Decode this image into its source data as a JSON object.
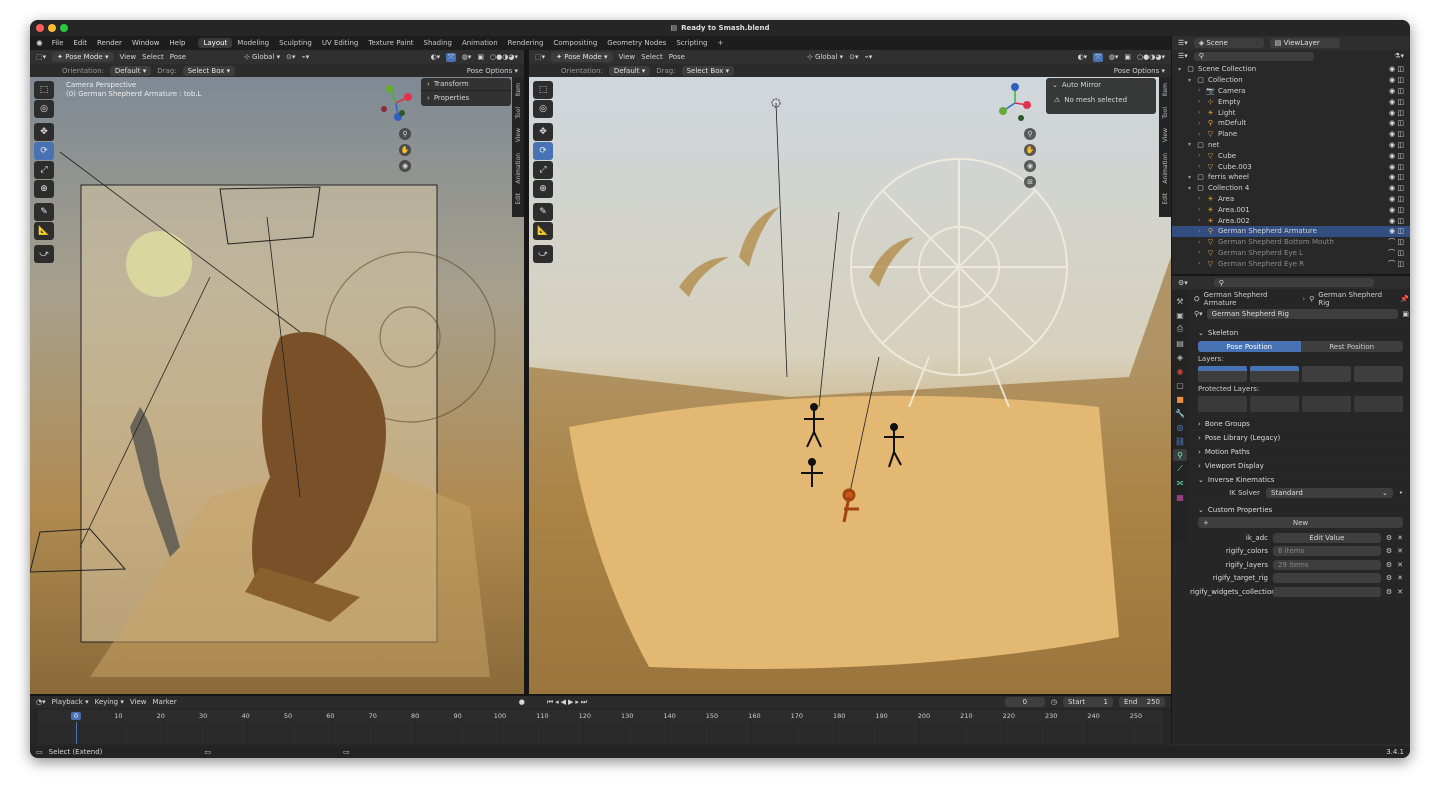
{
  "window": {
    "title": "Ready to Smash.blend",
    "version": "3.4.1"
  },
  "menu": {
    "items": [
      "File",
      "Edit",
      "Render",
      "Window",
      "Help"
    ]
  },
  "workspaces": [
    {
      "label": "Layout",
      "active": true
    },
    {
      "label": "Modeling"
    },
    {
      "label": "Sculpting"
    },
    {
      "label": "UV Editing"
    },
    {
      "label": "Texture Paint"
    },
    {
      "label": "Shading"
    },
    {
      "label": "Animation"
    },
    {
      "label": "Rendering"
    },
    {
      "label": "Compositing"
    },
    {
      "label": "Geometry Nodes"
    },
    {
      "label": "Scripting"
    }
  ],
  "left_viewport": {
    "mode": "Pose Mode",
    "menus": [
      "View",
      "Select",
      "Pose"
    ],
    "transform_space": "Global",
    "orientation_label": "Orientation:",
    "orientation_value": "Default",
    "drag_label": "Drag:",
    "drag_value": "Select Box",
    "pose_options": "Pose Options",
    "info_line1": "Camera Perspective",
    "info_line2": "(0) German Shepherd Armature : tob.L",
    "npanel": {
      "transform": "Transform",
      "properties": "Properties"
    },
    "tabs": [
      "Item",
      "Tool",
      "View",
      "Animation",
      "Edit"
    ]
  },
  "right_viewport": {
    "mode": "Pose Mode",
    "menus": [
      "View",
      "Select",
      "Pose"
    ],
    "transform_space": "Global",
    "orientation_label": "Orientation:",
    "orientation_value": "Default",
    "drag_label": "Drag:",
    "drag_value": "Select Box",
    "pose_options": "Pose Options",
    "auto_mirror": {
      "title": "Auto Mirror",
      "message": "No mesh selected"
    },
    "tabs": [
      "Item",
      "Tool",
      "View",
      "Animation",
      "Edit"
    ]
  },
  "outliner": {
    "scene": "Scene",
    "view_layer": "ViewLayer",
    "rows": [
      {
        "label": "Scene Collection",
        "depth": 0,
        "icon": "collection-icon"
      },
      {
        "label": "Collection",
        "depth": 1,
        "icon": "collection-icon"
      },
      {
        "label": "Camera",
        "depth": 2,
        "icon": "camera-icon"
      },
      {
        "label": "Empty",
        "depth": 2,
        "icon": "empty-icon"
      },
      {
        "label": "Light",
        "depth": 2,
        "icon": "light-icon"
      },
      {
        "label": "mDefult",
        "depth": 2,
        "icon": "armature-icon"
      },
      {
        "label": "Plane",
        "depth": 2,
        "icon": "mesh-icon"
      },
      {
        "label": "net",
        "depth": 1,
        "icon": "collection-icon"
      },
      {
        "label": "Cube",
        "depth": 2,
        "icon": "mesh-icon"
      },
      {
        "label": "Cube.003",
        "depth": 2,
        "icon": "mesh-icon"
      },
      {
        "label": "ferris wheel",
        "depth": 1,
        "icon": "collection-icon"
      },
      {
        "label": "Collection 4",
        "depth": 1,
        "icon": "collection-icon"
      },
      {
        "label": "Area",
        "depth": 2,
        "icon": "light-icon"
      },
      {
        "label": "Area.001",
        "depth": 2,
        "icon": "light-icon"
      },
      {
        "label": "Area.002",
        "depth": 2,
        "icon": "light-icon"
      },
      {
        "label": "German Shepherd Armature",
        "depth": 2,
        "icon": "armature-icon",
        "selected": true
      },
      {
        "label": "German Shepherd Bottom Mouth",
        "depth": 2,
        "icon": "mesh-icon",
        "dim": true
      },
      {
        "label": "German Shepherd Eye L",
        "depth": 2,
        "icon": "mesh-icon",
        "dim": true
      },
      {
        "label": "German Shepherd Eye R",
        "depth": 2,
        "icon": "mesh-icon",
        "dim": true
      }
    ]
  },
  "properties": {
    "breadcrumb": [
      "German Shepherd Armature",
      "German Shepherd Rig"
    ],
    "data_name": "German Shepherd Rig",
    "skeleton": {
      "title": "Skeleton",
      "pose_position": "Pose Position",
      "rest_position": "Rest Position",
      "layers_label": "Layers:",
      "protected_layers_label": "Protected Layers:"
    },
    "sections": [
      "Bone Groups",
      "Pose Library (Legacy)",
      "Motion Paths",
      "Viewport Display"
    ],
    "ik": {
      "title": "Inverse Kinematics",
      "solver_label": "IK Solver",
      "solver_value": "Standard"
    },
    "custom": {
      "title": "Custom Properties",
      "new_label": "New",
      "items": [
        {
          "key": "ik_adc",
          "value": "Edit Value"
        },
        {
          "key": "rigify_colors",
          "value": "6 items"
        },
        {
          "key": "rigify_layers",
          "value": "29 items"
        },
        {
          "key": "rigify_target_rig",
          "value": ""
        },
        {
          "key": "rigify_widgets_collection",
          "value": ""
        }
      ]
    }
  },
  "timeline": {
    "menus": [
      "Playback",
      "Keying",
      "View",
      "Marker"
    ],
    "current_frame": "0",
    "start_label": "Start",
    "start": "1",
    "end_label": "End",
    "end": "250",
    "ticks": [
      "0",
      "10",
      "20",
      "30",
      "40",
      "50",
      "60",
      "70",
      "80",
      "90",
      "100",
      "110",
      "120",
      "130",
      "140",
      "150",
      "160",
      "170",
      "180",
      "190",
      "200",
      "210",
      "220",
      "230",
      "240",
      "250"
    ]
  },
  "status": {
    "left": "Select (Extend)"
  },
  "colors": {
    "accent": "#4772b3",
    "active_tab": "#3a3a3a",
    "selected_row": "#334d80"
  }
}
